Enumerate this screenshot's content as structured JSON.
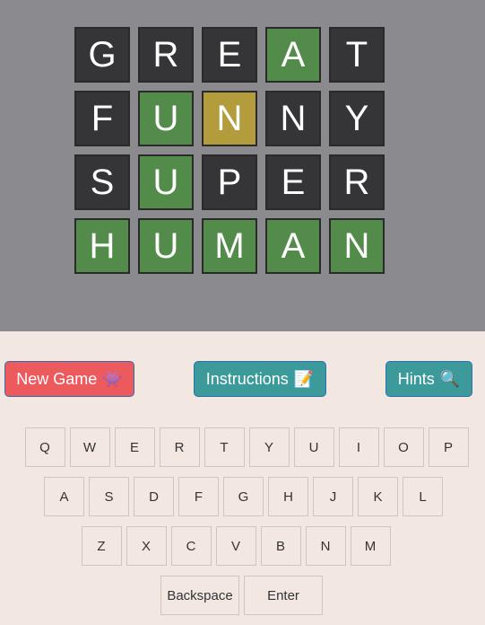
{
  "board": {
    "rows": [
      [
        {
          "letter": "G",
          "state": "absent"
        },
        {
          "letter": "R",
          "state": "absent"
        },
        {
          "letter": "E",
          "state": "absent"
        },
        {
          "letter": "A",
          "state": "correct"
        },
        {
          "letter": "T",
          "state": "absent"
        }
      ],
      [
        {
          "letter": "F",
          "state": "absent"
        },
        {
          "letter": "U",
          "state": "correct"
        },
        {
          "letter": "N",
          "state": "present"
        },
        {
          "letter": "N",
          "state": "absent"
        },
        {
          "letter": "Y",
          "state": "absent"
        }
      ],
      [
        {
          "letter": "S",
          "state": "absent"
        },
        {
          "letter": "U",
          "state": "correct"
        },
        {
          "letter": "P",
          "state": "absent"
        },
        {
          "letter": "E",
          "state": "absent"
        },
        {
          "letter": "R",
          "state": "absent"
        }
      ],
      [
        {
          "letter": "H",
          "state": "correct"
        },
        {
          "letter": "U",
          "state": "correct"
        },
        {
          "letter": "M",
          "state": "correct"
        },
        {
          "letter": "A",
          "state": "correct"
        },
        {
          "letter": "N",
          "state": "correct"
        }
      ]
    ]
  },
  "buttons": {
    "new_game": {
      "label": "New Game",
      "emoji": "👾"
    },
    "instructions": {
      "label": "Instructions",
      "emoji": "📝"
    },
    "hints": {
      "label": "Hints",
      "emoji": "🔍"
    }
  },
  "keyboard": {
    "rows": [
      [
        "Q",
        "W",
        "E",
        "R",
        "T",
        "Y",
        "U",
        "I",
        "O",
        "P"
      ],
      [
        "A",
        "S",
        "D",
        "F",
        "G",
        "H",
        "J",
        "K",
        "L"
      ],
      [
        "Z",
        "X",
        "C",
        "V",
        "B",
        "N",
        "M"
      ],
      [
        "Backspace",
        "Enter"
      ]
    ]
  },
  "colors": {
    "absent": "#353537",
    "correct": "#538b4a",
    "present": "#b29c3c",
    "board_bg": "#8b8a8f",
    "page_bg": "#f3e7e2"
  }
}
